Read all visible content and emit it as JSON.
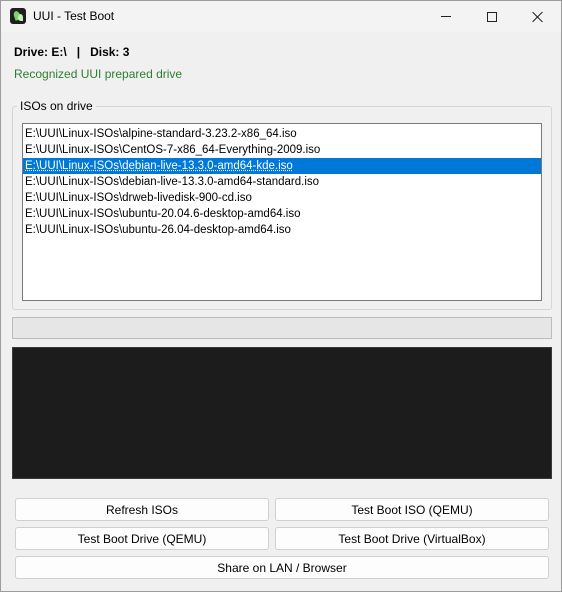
{
  "window": {
    "title": "UUI - Test Boot"
  },
  "drive": {
    "drive_label": "Drive: E:\\",
    "separator": "|",
    "disk_label": "Disk: 3"
  },
  "status": {
    "text": "Recognized UUI prepared drive",
    "color": "#2e7d32"
  },
  "iso_group": {
    "label": "ISOs on drive",
    "items": [
      "E:\\UUI\\Linux-ISOs\\alpine-standard-3.23.2-x86_64.iso",
      "E:\\UUI\\Linux-ISOs\\CentOS-7-x86_64-Everything-2009.iso",
      "E:\\UUI\\Linux-ISOs\\debian-live-13.3.0-amd64-kde.iso",
      "E:\\UUI\\Linux-ISOs\\debian-live-13.3.0-amd64-standard.iso",
      "E:\\UUI\\Linux-ISOs\\drweb-livedisk-900-cd.iso",
      "E:\\UUI\\Linux-ISOs\\ubuntu-20.04.6-desktop-amd64.iso",
      "E:\\UUI\\Linux-ISOs\\ubuntu-26.04-desktop-amd64.iso"
    ],
    "selected_index": 2,
    "selection_color": "#0078d7"
  },
  "progress": {
    "value": 0
  },
  "console": {
    "background": "#1c1c1c"
  },
  "buttons": {
    "refresh_isos": "Refresh ISOs",
    "test_boot_iso": "Test Boot ISO (QEMU)",
    "test_boot_drive_qemu": "Test Boot Drive (QEMU)",
    "test_boot_drive_vbox": "Test Boot Drive (VirtualBox)",
    "share_lan": "Share on LAN / Browser"
  },
  "icons": {
    "app": "uui-leaf-icon",
    "minimize": "minimize-icon",
    "maximize": "maximize-icon",
    "close": "close-icon"
  }
}
